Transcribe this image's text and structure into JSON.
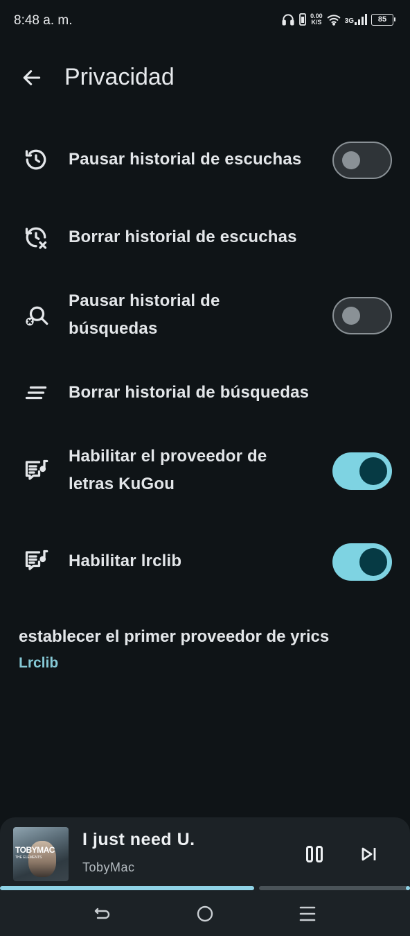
{
  "status_bar": {
    "time": "8:48 a. m.",
    "net_speed_value": "0.00",
    "net_speed_unit": "K/S",
    "network_type": "3G",
    "battery_level": "85",
    "icons": [
      "headphones-icon",
      "vibrate-icon",
      "wifi-icon",
      "signal-icon",
      "battery-icon"
    ]
  },
  "header": {
    "title": "Privacidad",
    "back_icon": "arrow-left-icon"
  },
  "settings": [
    {
      "label_lines": [
        "Pausar historial de escuchas"
      ],
      "icon": "history-icon",
      "toggle": "off"
    },
    {
      "label_lines": [
        "Borrar historial de escuchas"
      ],
      "icon": "history-clear-icon",
      "toggle": null
    },
    {
      "label_lines": [
        "Pausar historial de",
        "búsquedas"
      ],
      "icon": "search-off-icon",
      "toggle": "off"
    },
    {
      "label_lines": [
        "Borrar historial de búsquedas"
      ],
      "icon": "clear-all-icon",
      "toggle": null
    },
    {
      "label_lines": [
        "Habilitar el proveedor de",
        "letras KuGou"
      ],
      "icon": "lyrics-icon",
      "toggle": "on"
    },
    {
      "label_lines": [
        "Habilitar lrclib"
      ],
      "icon": "lyrics-icon",
      "toggle": "on"
    }
  ],
  "lyrics_provider": {
    "title": "establecer el primer proveedor de yrics",
    "value": "Lrclib"
  },
  "mini_player": {
    "album_brand": "TOBYMAC",
    "album_subtitle": "THE ELEMENTS",
    "title": "I just need U.",
    "artist": "TobyMac",
    "playback_progress": 0.62,
    "pause_icon": "pause-icon",
    "next_icon": "skip-next-icon"
  },
  "nav_bar": {
    "icons": [
      "back-nav-icon",
      "home-nav-icon",
      "recents-nav-icon"
    ]
  },
  "colors": {
    "background": "#0f1417",
    "accent": "#7ed3e2",
    "toggle_on_knob": "#063a44",
    "provider_value": "#86c9d6"
  }
}
